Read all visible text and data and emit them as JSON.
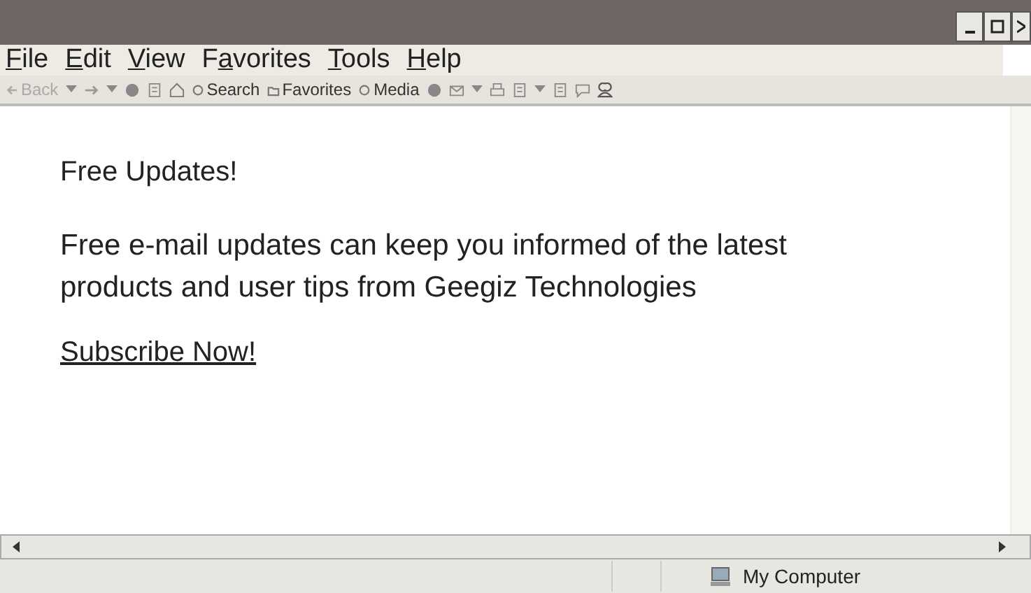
{
  "menu": [
    {
      "key": "F",
      "post": "ile"
    },
    {
      "key": "E",
      "post": "dit"
    },
    {
      "key": "V",
      "post": "iew"
    },
    {
      "pre": "F",
      "key": "a",
      "post": "vorites"
    },
    {
      "key": "T",
      "post": "ools"
    },
    {
      "key": "H",
      "post": "elp"
    }
  ],
  "toolbar": [
    {
      "kind": "text",
      "label": "Back",
      "disabled": true
    },
    {
      "kind": "dropdown"
    },
    {
      "kind": "icon"
    },
    {
      "kind": "dropdown"
    },
    {
      "kind": "icon"
    },
    {
      "kind": "icon"
    },
    {
      "kind": "icon"
    },
    {
      "kind": "text",
      "label": "Search",
      "disabled": false
    },
    {
      "kind": "text",
      "label": "Favorites",
      "disabled": false
    },
    {
      "kind": "text",
      "label": "Media",
      "disabled": false
    },
    {
      "kind": "icon"
    },
    {
      "kind": "icon"
    },
    {
      "kind": "dropdown"
    },
    {
      "kind": "icon"
    },
    {
      "kind": "icon"
    },
    {
      "kind": "dropdown"
    },
    {
      "kind": "icon"
    },
    {
      "kind": "icon"
    },
    {
      "kind": "icon"
    }
  ],
  "content": {
    "heading": "Free Updates!",
    "body": "Free e-mail updates can keep you informed of the latest products and user tips from Geegiz Technologies",
    "link": "Subscribe Now!"
  },
  "status_bar": {
    "zone": "My Computer"
  }
}
